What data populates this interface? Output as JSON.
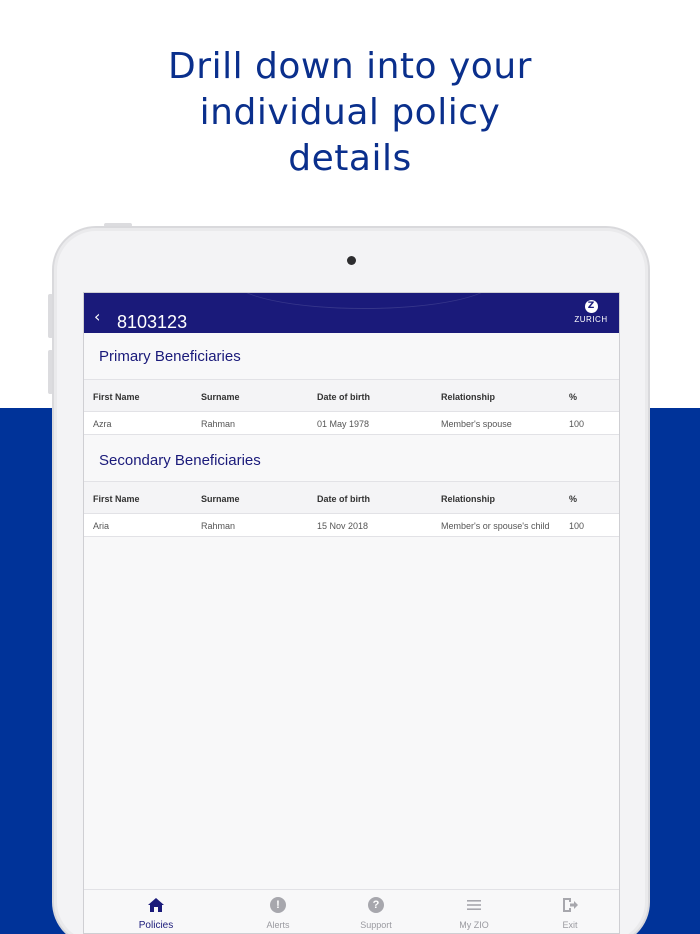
{
  "headline": {
    "line1": "Drill down into your",
    "line2": "individual policy",
    "line3": "details"
  },
  "app": {
    "back_icon": "chevron-left-icon",
    "policy_number": "8103123",
    "brand_name": "ZURICH",
    "brand_mark": "Z",
    "colors": {
      "header": "#1a1a7a",
      "band": "#003399",
      "headline": "#0a2f8c"
    }
  },
  "primary": {
    "title": "Primary Beneficiaries",
    "columns": [
      "First Name",
      "Surname",
      "Date of birth",
      "Relationship",
      "%"
    ],
    "rows": [
      [
        "Azra",
        "Rahman",
        "01 May 1978",
        "Member's spouse",
        "100"
      ]
    ]
  },
  "secondary": {
    "title": "Secondary Beneficiaries",
    "columns": [
      "First Name",
      "Surname",
      "Date of birth",
      "Relationship",
      "%"
    ],
    "rows": [
      [
        "Aria",
        "Rahman",
        "15 Nov 2018",
        "Member's or spouse's child",
        "100"
      ]
    ]
  },
  "tabs": [
    {
      "label": "Policies",
      "icon": "home-icon",
      "active": true
    },
    {
      "label": "Alerts",
      "icon": "exclamation-icon",
      "active": false
    },
    {
      "label": "Support",
      "icon": "question-icon",
      "active": false
    },
    {
      "label": "My ZIO",
      "icon": "menu-icon",
      "active": false
    },
    {
      "label": "Exit",
      "icon": "exit-icon",
      "active": false
    }
  ]
}
